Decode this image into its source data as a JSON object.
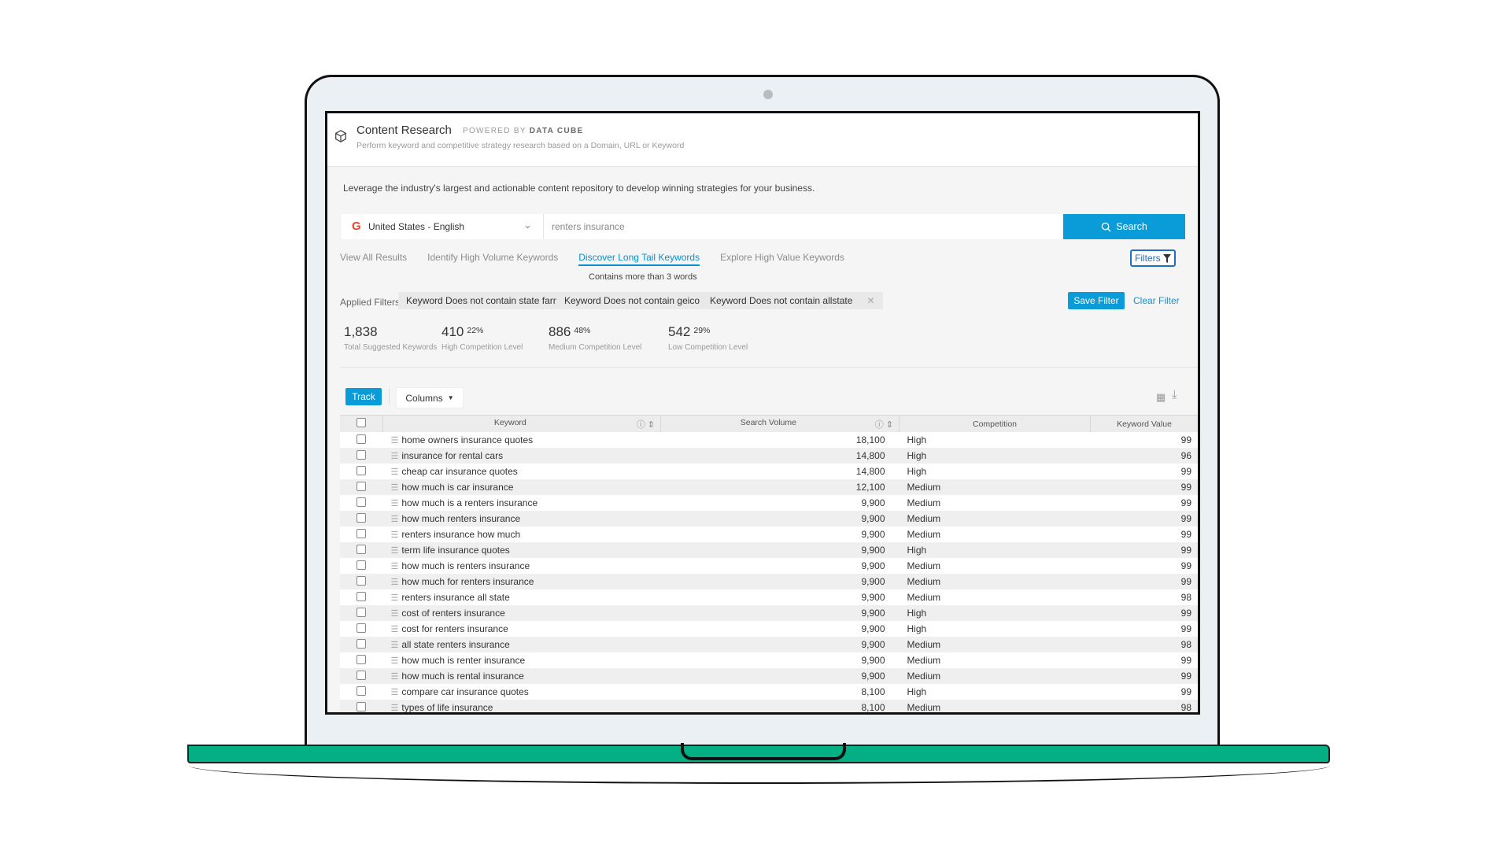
{
  "header": {
    "title": "Content Research",
    "powered_prefix": "POWERED BY",
    "powered_brand": "DATA CUBE",
    "subtitle": "Perform keyword and competitive strategy research based on a Domain, URL or Keyword"
  },
  "intro": "Leverage the industry's largest and actionable content repository to develop winning strategies for your business.",
  "search": {
    "locale": "United States - English",
    "query": "renters insurance",
    "button_label": "Search"
  },
  "tabs": [
    {
      "label": "View All Results",
      "active": false
    },
    {
      "label": "Identify High Volume Keywords",
      "active": false
    },
    {
      "label": "Discover Long Tail Keywords",
      "active": true
    },
    {
      "label": "Explore High Value Keywords",
      "active": false
    }
  ],
  "filters_button": "Filters",
  "tab_description": "Contains more than 3 words",
  "applied_filters": {
    "label": "Applied Filters:",
    "chips": [
      "Keyword Does not contain state farm",
      "Keyword Does not contain geico",
      "Keyword Does not contain allstate"
    ],
    "save_label": "Save Filter",
    "clear_label": "Clear Filter"
  },
  "stats": [
    {
      "value": "1,838",
      "pct": "",
      "label": "Total Suggested Keywords"
    },
    {
      "value": "410",
      "pct": "22%",
      "label": "High Competition Level"
    },
    {
      "value": "886",
      "pct": "48%",
      "label": "Medium Competition Level"
    },
    {
      "value": "542",
      "pct": "29%",
      "label": "Low Competition Level"
    }
  ],
  "toolbar": {
    "track_label": "Track",
    "columns_label": "Columns"
  },
  "table": {
    "columns": [
      "Keyword",
      "Search Volume",
      "Competition",
      "Keyword Value"
    ],
    "rows": [
      {
        "keyword": "home owners insurance quotes",
        "volume": "18,100",
        "competition": "High",
        "value": "99"
      },
      {
        "keyword": "insurance for rental cars",
        "volume": "14,800",
        "competition": "High",
        "value": "96"
      },
      {
        "keyword": "cheap car insurance quotes",
        "volume": "14,800",
        "competition": "High",
        "value": "99"
      },
      {
        "keyword": "how much is car insurance",
        "volume": "12,100",
        "competition": "Medium",
        "value": "99"
      },
      {
        "keyword": "how much is a renters insurance",
        "volume": "9,900",
        "competition": "Medium",
        "value": "99"
      },
      {
        "keyword": "how much renters insurance",
        "volume": "9,900",
        "competition": "Medium",
        "value": "99"
      },
      {
        "keyword": "renters insurance how much",
        "volume": "9,900",
        "competition": "Medium",
        "value": "99"
      },
      {
        "keyword": "term life insurance quotes",
        "volume": "9,900",
        "competition": "High",
        "value": "99"
      },
      {
        "keyword": "how much is renters insurance",
        "volume": "9,900",
        "competition": "Medium",
        "value": "99"
      },
      {
        "keyword": "how much for renters insurance",
        "volume": "9,900",
        "competition": "Medium",
        "value": "99"
      },
      {
        "keyword": "renters insurance all state",
        "volume": "9,900",
        "competition": "Medium",
        "value": "98"
      },
      {
        "keyword": "cost of renters insurance",
        "volume": "9,900",
        "competition": "High",
        "value": "99"
      },
      {
        "keyword": "cost for renters insurance",
        "volume": "9,900",
        "competition": "High",
        "value": "99"
      },
      {
        "keyword": "all state renters insurance",
        "volume": "9,900",
        "competition": "Medium",
        "value": "98"
      },
      {
        "keyword": "how much is renter insurance",
        "volume": "9,900",
        "competition": "Medium",
        "value": "99"
      },
      {
        "keyword": "how much is rental insurance",
        "volume": "9,900",
        "competition": "Medium",
        "value": "99"
      },
      {
        "keyword": "compare car insurance quotes",
        "volume": "8,100",
        "competition": "High",
        "value": "99"
      },
      {
        "keyword": "types of life insurance",
        "volume": "8,100",
        "competition": "Medium",
        "value": "98"
      }
    ]
  },
  "colors": {
    "accent": "#0a9bd9",
    "laptop_base": "#03b083",
    "laptop_bezel": "#ebf0f4"
  }
}
